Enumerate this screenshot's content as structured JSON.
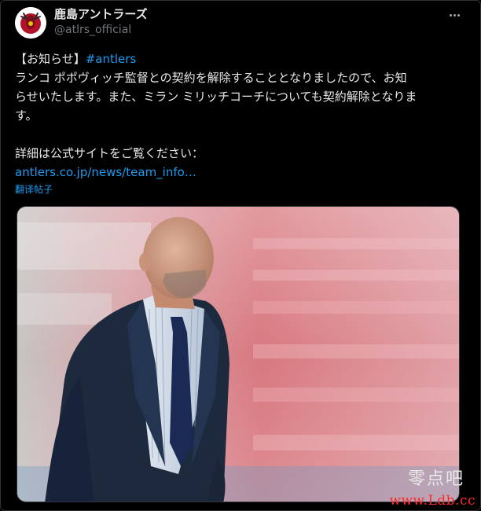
{
  "post": {
    "display_name": "鹿島アントラーズ",
    "handle": "@atlrs_official",
    "more_label": "More",
    "body": {
      "prefix": "【お知らせ】",
      "hashtag": "#antlers",
      "line1": "ランコ ポポヴィッチ監督との契約を解除することとなりましたので、お知",
      "line2": "らせいたします。また、ミラン ミリッチコーチについても契約解除となりま",
      "line3": "す。",
      "details": "詳細は公式サイトをご覧ください：",
      "link": "antlers.co.jp/news/team_info…"
    },
    "translate_label": "翻译帖子"
  },
  "watermark": {
    "title": "零点吧",
    "url": "www.Ldb.cc"
  },
  "colors": {
    "background": "#000000",
    "text": "#e7e9ea",
    "muted": "#71767b",
    "accent": "#1d9bf0",
    "watermark_url": "#ff2a2a"
  },
  "icons": {
    "avatar": "antlers-club-crest",
    "more": "ellipsis-icon"
  }
}
